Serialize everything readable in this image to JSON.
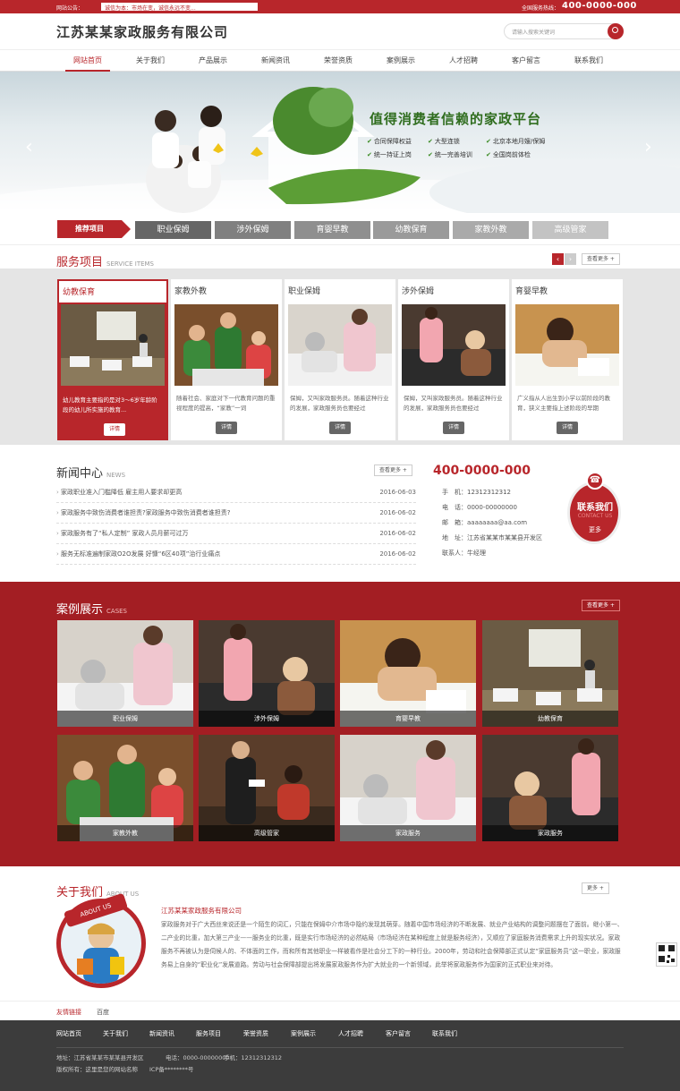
{
  "topbar": {
    "notice_label": "网站公告：",
    "notice_text": "诚信为本：市场在变，诚信永远不变...",
    "hotline_label": "全国服务热线：",
    "hotline": "400-0000-000"
  },
  "header": {
    "company": "江苏某某家政服务有限公司",
    "search_placeholder": "请输入搜索关键词"
  },
  "nav": [
    "网站首页",
    "关于我们",
    "产品展示",
    "新闻资讯",
    "荣誉资质",
    "案例展示",
    "人才招聘",
    "客户留言",
    "联系我们"
  ],
  "banner": {
    "tagline": "值得消费者信赖的家政平台",
    "features": [
      "合同保障权益",
      "大型连锁",
      "北京本地月嫂/保姆",
      "统一持证上岗",
      "统一完善培训",
      "全国岗前体检"
    ],
    "prev_icon": "‹",
    "next_icon": "›"
  },
  "recommend": {
    "label": "推荐项目",
    "tabs": [
      "职业保姆",
      "涉外保姆",
      "育婴早教",
      "幼教保育",
      "家教外教",
      "高级管家"
    ]
  },
  "services": {
    "title": "服务项目",
    "subtitle": "SERVICE ITEMS",
    "more": "查看更多",
    "items": [
      {
        "title": "幼教保育",
        "desc": "幼儿教育主要指的是对3～6岁年龄阶段的幼儿所实施的教育...",
        "btn": "详情"
      },
      {
        "title": "家教外教",
        "desc": "随着社会、家庭对下一代教育问题的重视程度的提高，“家教”一词",
        "btn": "详情"
      },
      {
        "title": "职业保姆",
        "desc": "保姆，又叫家政服务员。随着这种行业的发展，家政服务员也要经过",
        "btn": "详情"
      },
      {
        "title": "涉外保姆",
        "desc": "保姆，又叫家政服务员。随着这种行业的发展，家政服务员也要经过",
        "btn": "详情"
      },
      {
        "title": "育婴早教",
        "desc": "广义指从人出生到小学以前阶段的教育，狭义主要指上述阶段的早期",
        "btn": "详情"
      }
    ]
  },
  "news": {
    "title": "新闻中心",
    "subtitle": "NEWS",
    "more": "查看更多",
    "items": [
      {
        "text": "家政职业准入门槛降低 雇主用人要求却更高",
        "date": "2016-06-03"
      },
      {
        "text": "家政服务中致伤消费者谁担责?家政服务中致伤消费者谁担责?",
        "date": "2016-06-02"
      },
      {
        "text": "家政服务有了“私人定制” 家政人员月薪可过万",
        "date": "2016-06-02"
      },
      {
        "text": "服务无标准遍制家政O2O发展 好慷“6区40项”治行业痛点",
        "date": "2016-06-02"
      }
    ]
  },
  "contact": {
    "phone": "400-0000-000",
    "lines": [
      "手　机：12312312312",
      "电　话：0000-00000000",
      "邮　箱：aaaaaaaa@aa.com",
      "地　址：江苏省某某市某某县开发区",
      "联系人：牛经理"
    ],
    "badge_title": "联系我们",
    "badge_sub": "CONTACT US",
    "badge_more": "更多"
  },
  "cases": {
    "title": "案例展示",
    "subtitle": "CASES",
    "more": "查看更多",
    "items": [
      "职业保姆",
      "涉外保姆",
      "育婴早教",
      "幼教保育",
      "家教外教",
      "高级管家",
      "家政服务",
      "家政服务"
    ]
  },
  "about": {
    "title": "关于我们",
    "subtitle": "ABOUT US",
    "more": "更多",
    "badge": "ABOUT US",
    "company": "江苏某某家政服务有限公司",
    "text": "家政服务对于广大西丝来说还是一个陌生的词汇，只能在保姆中介市场中隐约发现其萌芽。随着中国市场经济的不断发展、就业产业结构的调整问题摆在了面前。继小第一、二产业的比重，加大第三产业——服务业的比重，既是实行市场经济的必然结局（市场经济在某种程度上就是服务经济），又顺应了家庭服务消费需求上升的现实状况。家政服务不再被认为是伺候人的、不体面的工作，而和所有其他职业一样被看作是社会分工下的一种行业。2000年，劳动和社会保障部正式认定“家庭服务员”这一职业，家政服务易上自身的“职业化”发展道路。劳动与社会保障部提出将发展家政服务作为扩大就业的一个新领域，此举将家政服务作为国家的正式职业来对待。"
  },
  "friend": {
    "label": "友情链接",
    "links": [
      "百度"
    ]
  },
  "footer": {
    "nav": [
      "网站首页",
      "关于我们",
      "新闻资讯",
      "服务项目",
      "荣誉资质",
      "案例展示",
      "人才招聘",
      "客户留言",
      "联系我们"
    ],
    "address": "地址：江苏省某某市某某县开发区",
    "tel": "电话：0000-00000000",
    "mobile": "手机：12312312312",
    "copyright": "版权所有：这里是您的网站名称",
    "icp": "ICP备********号"
  }
}
